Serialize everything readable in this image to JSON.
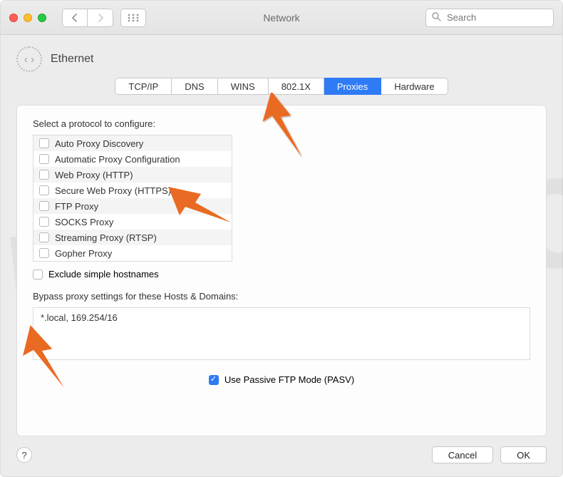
{
  "titlebar": {
    "title": "Network",
    "search_placeholder": "Search"
  },
  "header": {
    "interface": "Ethernet",
    "icon_glyph": "‹ ›"
  },
  "tabs": [
    {
      "id": "tcpip",
      "label": "TCP/IP",
      "active": false
    },
    {
      "id": "dns",
      "label": "DNS",
      "active": false
    },
    {
      "id": "wins",
      "label": "WINS",
      "active": false
    },
    {
      "id": "8021x",
      "label": "802.1X",
      "active": false
    },
    {
      "id": "proxies",
      "label": "Proxies",
      "active": true
    },
    {
      "id": "hardware",
      "label": "Hardware",
      "active": false
    }
  ],
  "section": {
    "select_protocol_label": "Select a protocol to configure:",
    "protocols": [
      {
        "label": "Auto Proxy Discovery",
        "checked": false
      },
      {
        "label": "Automatic Proxy Configuration",
        "checked": false
      },
      {
        "label": "Web Proxy (HTTP)",
        "checked": false
      },
      {
        "label": "Secure Web Proxy (HTTPS)",
        "checked": false
      },
      {
        "label": "FTP Proxy",
        "checked": false
      },
      {
        "label": "SOCKS Proxy",
        "checked": false
      },
      {
        "label": "Streaming Proxy (RTSP)",
        "checked": false
      },
      {
        "label": "Gopher Proxy",
        "checked": false
      }
    ],
    "exclude_simple_label": "Exclude simple hostnames",
    "exclude_simple_checked": false,
    "bypass_label": "Bypass proxy settings for these Hosts & Domains:",
    "bypass_value": "*.local, 169.254/16",
    "pasv_label": "Use Passive FTP Mode (PASV)",
    "pasv_checked": true
  },
  "footer": {
    "help": "?",
    "cancel": "Cancel",
    "ok": "OK"
  },
  "watermark": "pcrisk.com"
}
